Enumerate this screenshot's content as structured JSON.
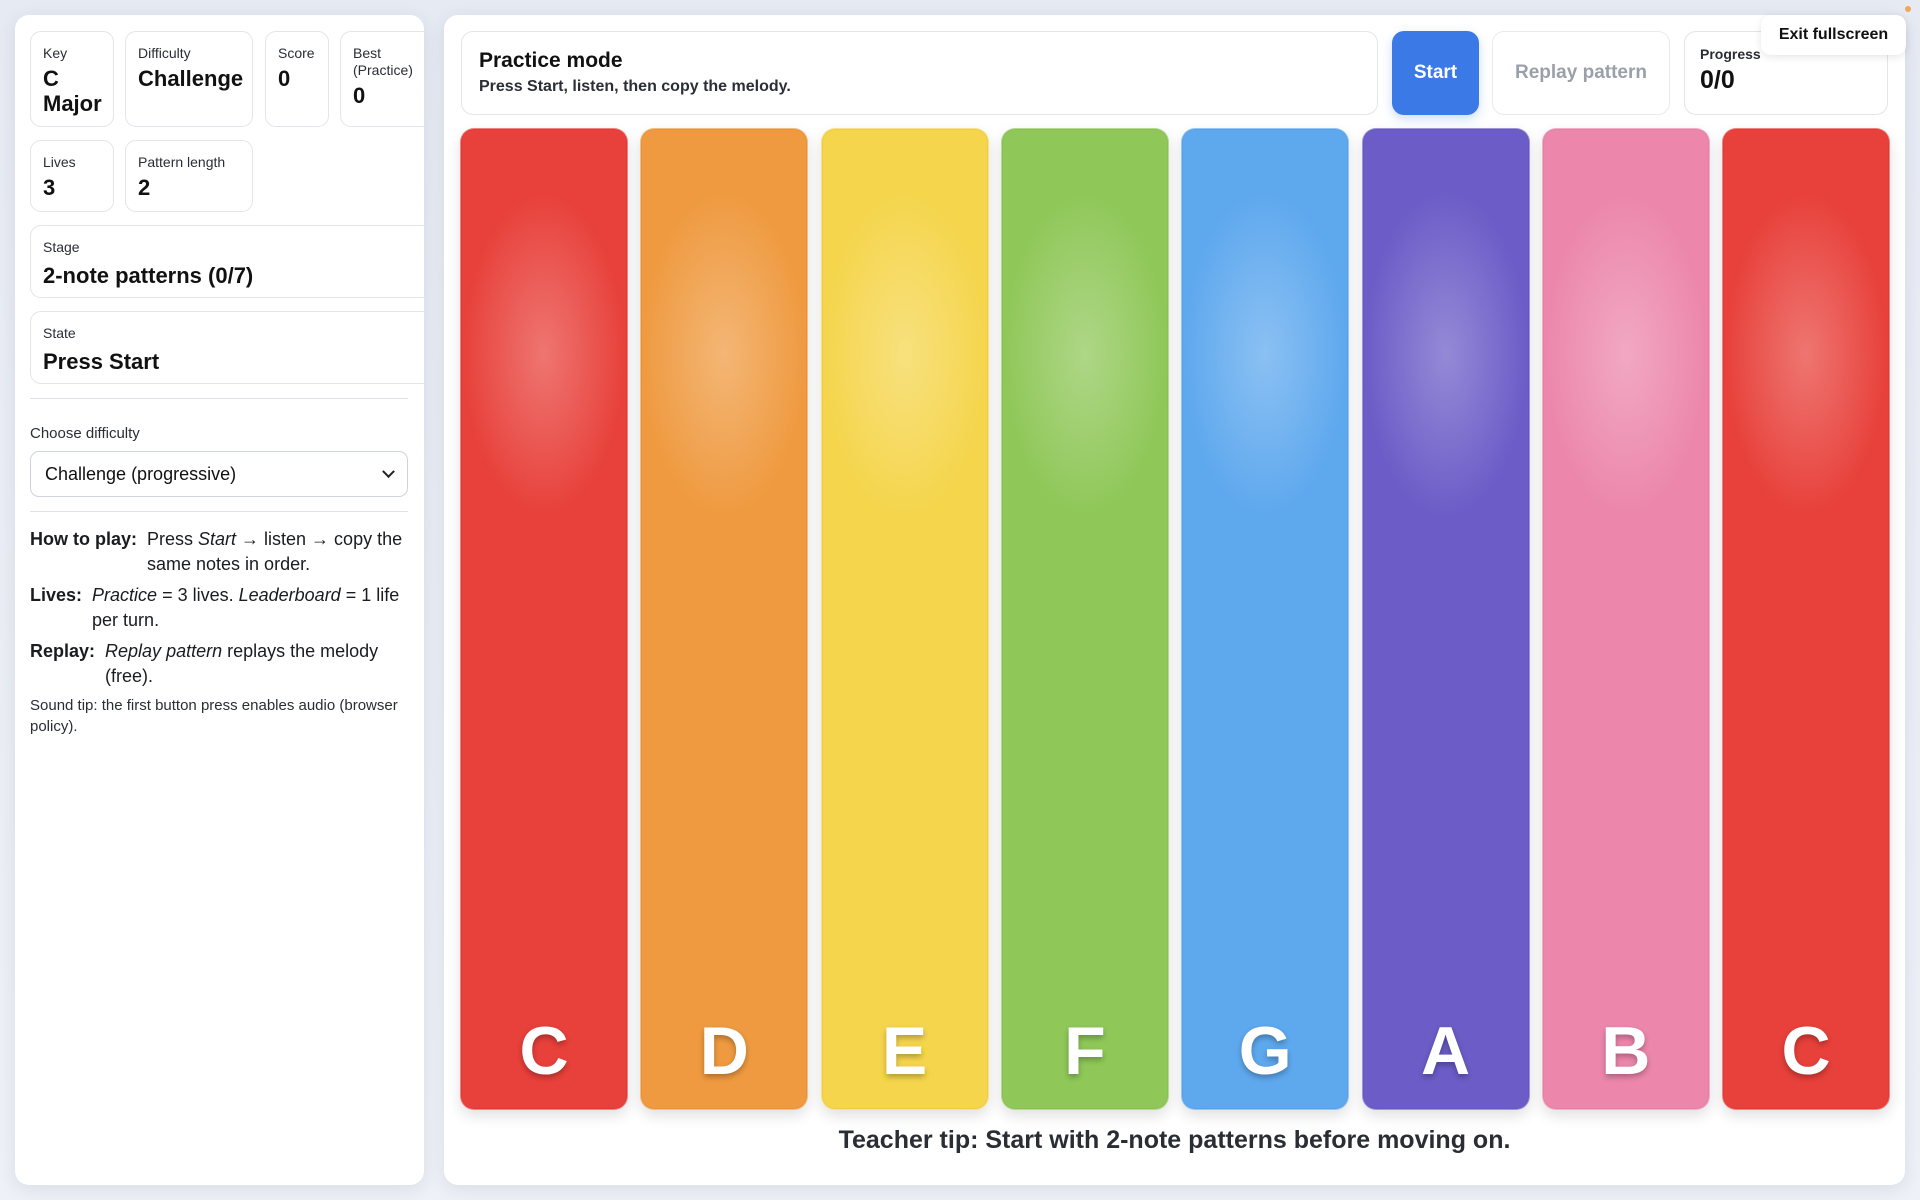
{
  "stats": {
    "key": {
      "label": "Key",
      "value": "C Major"
    },
    "difficulty": {
      "label": "Difficulty",
      "value": "Challenge"
    },
    "score": {
      "label": "Score",
      "value": "0"
    },
    "best": {
      "label": "Best (Practice)",
      "value": "0"
    },
    "lives": {
      "label": "Lives",
      "value": "3"
    },
    "pattern_length": {
      "label": "Pattern length",
      "value": "2"
    },
    "stage": {
      "label": "Stage",
      "value": "2-note patterns (0/7)"
    },
    "state": {
      "label": "State",
      "value": "Press Start"
    }
  },
  "difficulty_select": {
    "label": "Choose difficulty",
    "selected": "Challenge (progressive)"
  },
  "instructions": {
    "how_to_play": {
      "label": "How to play:",
      "text_1": "Press ",
      "em_1": "Start",
      "text_2": " → listen → copy the same notes in order."
    },
    "lives": {
      "label": "Lives:",
      "em_1": "Practice",
      "text_1": " = 3 lives. ",
      "em_2": "Leaderboard",
      "text_2": " = 1 life per turn."
    },
    "replay": {
      "label": "Replay:",
      "em_1": "Replay pattern",
      "text_1": " replays the melody (free)."
    },
    "sound_tip": "Sound tip: the first button press enables audio (browser policy)."
  },
  "header": {
    "mode_title": "Practice mode",
    "mode_subtitle": "Press Start, listen, then copy the melody.",
    "start_label": "Start",
    "replay_label": "Replay pattern",
    "progress_label": "Progress",
    "progress_value": "0/0",
    "exit_fullscreen_label": "Exit fullscreen"
  },
  "keys": [
    {
      "note": "C",
      "color": "#e8403a"
    },
    {
      "note": "D",
      "color": "#ef9a40"
    },
    {
      "note": "E",
      "color": "#f5d54c"
    },
    {
      "note": "F",
      "color": "#8fc758"
    },
    {
      "note": "G",
      "color": "#5ea8ee"
    },
    {
      "note": "A",
      "color": "#6b5cc7"
    },
    {
      "note": "B",
      "color": "#ec86ab"
    },
    {
      "note": "C",
      "color": "#e8403a"
    }
  ],
  "teacher_tip": "Teacher tip: Start with 2-note patterns before moving on."
}
